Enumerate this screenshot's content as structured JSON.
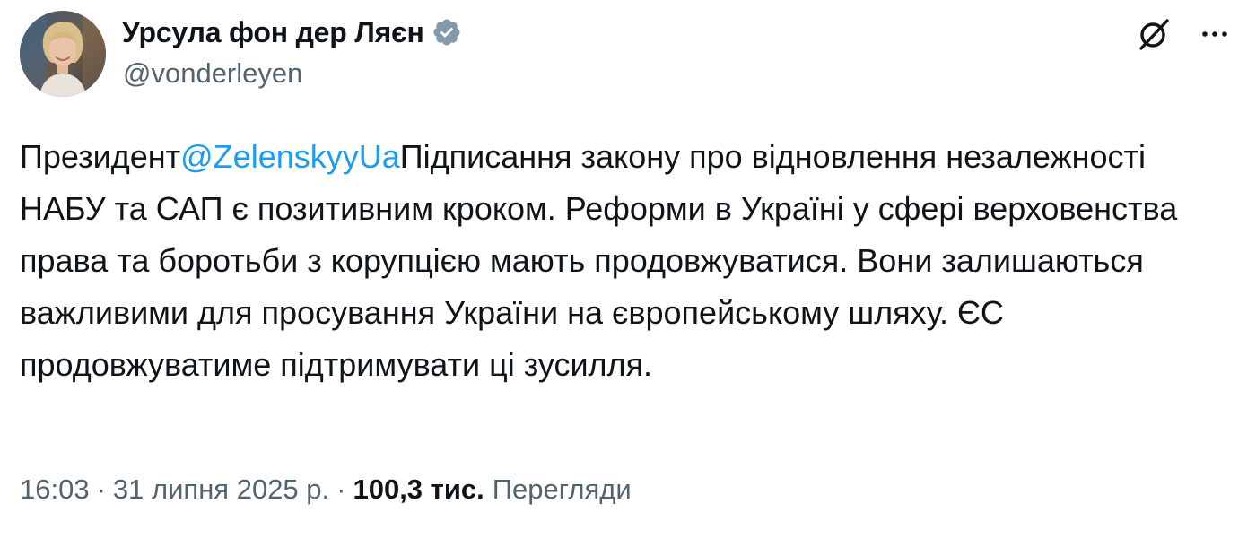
{
  "author": {
    "display_name": "Урсула фон дер Ляєн",
    "handle": "@vonderleyen",
    "verified_badge_icon": "verified-badge-icon",
    "badge_color": "#829aab"
  },
  "toolbar": {
    "grok_icon": "grok-icon",
    "more_icon": "more-options-icon"
  },
  "tweet": {
    "text_before_mention": "Президент",
    "mention": "@ZelenskyyUa",
    "text_after_mention": "Підписання закону про відновлення незалежності НАБУ та САП є позитивним кроком. Реформи в Україні у сфері верховенства права та боротьби з корупцією мають продовжуватися. Вони залишаються важливими для просування України на європейському шляху. ЄС продовжуватиме підтримувати ці зусилля."
  },
  "meta": {
    "time": "16:03",
    "separator": "·",
    "date": "31 липня 2025 р.",
    "views_count": "100,3 тис.",
    "views_label": "Перегляди"
  },
  "colors": {
    "text": "#0f1419",
    "secondary": "#536471",
    "link": "#1d9bf0"
  }
}
